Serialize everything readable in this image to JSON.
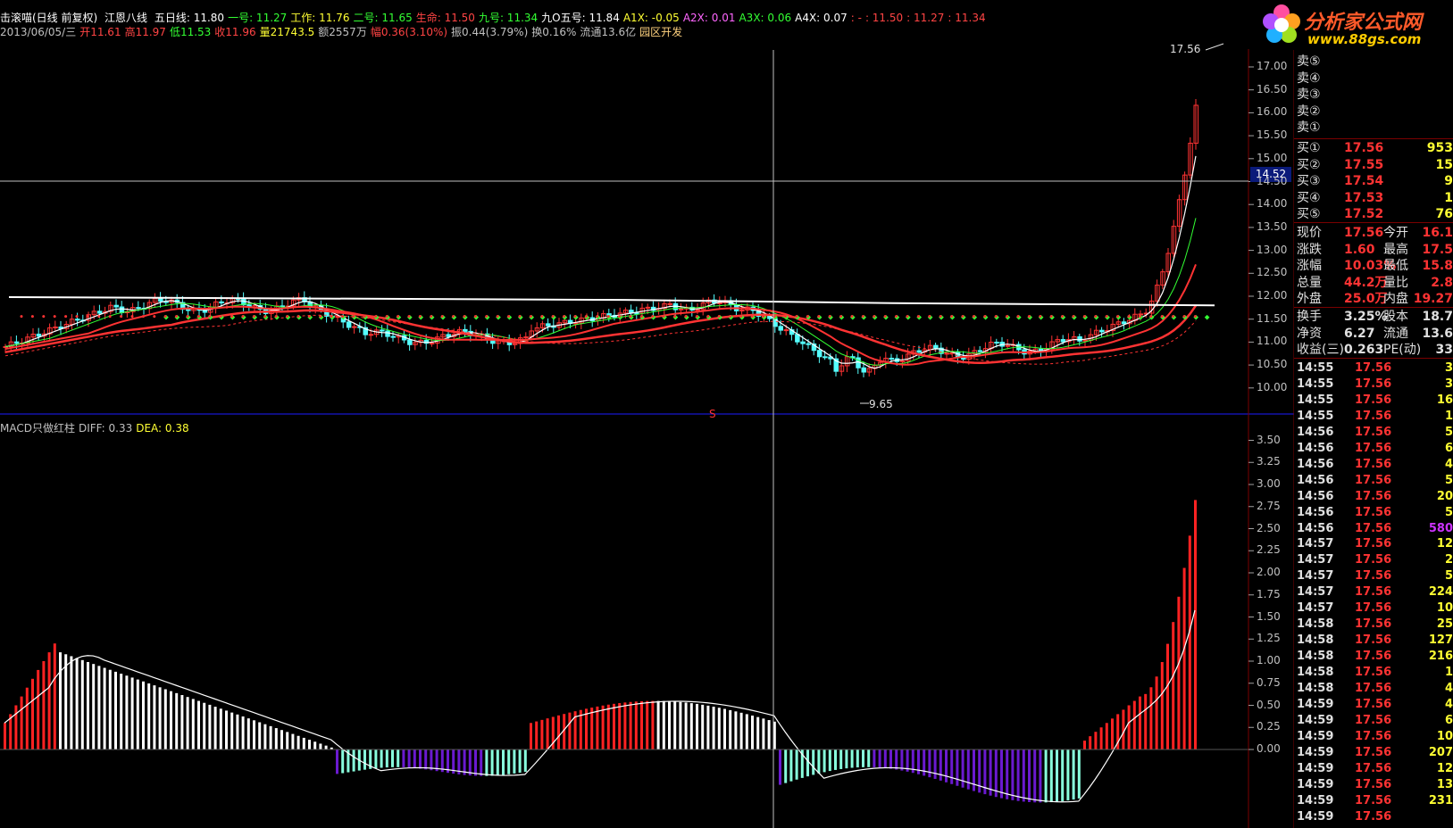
{
  "header": {
    "title": "击滚喵(日线 前复权)",
    "indicator": "江恩八线",
    "items": [
      {
        "label": "五日线: 11.80",
        "color": "#ffffff"
      },
      {
        "label": "一号: 11.27",
        "color": "#33ff33"
      },
      {
        "label": "工作: 11.76",
        "color": "#ffff33"
      },
      {
        "label": "二号: 11.65",
        "color": "#33ff33"
      },
      {
        "label": "生命: 11.50",
        "color": "#ff4444"
      },
      {
        "label": "九号: 11.34",
        "color": "#33ff33"
      },
      {
        "label": "九O五号: 11.84",
        "color": "#ffffff"
      },
      {
        "label": "A1X: -0.05",
        "color": "#ffff33"
      },
      {
        "label": "A2X: 0.01",
        "color": "#ff66ff"
      },
      {
        "label": "A3X: 0.06",
        "color": "#33ff33"
      },
      {
        "label": "A4X: 0.07",
        "color": "#ffffff"
      },
      {
        "label": ": -",
        "color": "#ff4444"
      },
      {
        "label": ": 11.50",
        "color": "#ff4444"
      },
      {
        "label": ": 11.27",
        "color": "#ff4444"
      },
      {
        "label": ": 11.34",
        "color": "#ff4444"
      }
    ]
  },
  "quote": {
    "items": [
      {
        "label": "2013/06/05/三",
        "color": "#c0c0c0"
      },
      {
        "label": "开11.61",
        "color": "#ff4444"
      },
      {
        "label": "高11.97",
        "color": "#ff4444"
      },
      {
        "label": "低11.53",
        "color": "#33ff33"
      },
      {
        "label": "收11.96",
        "color": "#ff4444"
      },
      {
        "label": "量21743.5",
        "color": "#ffff33"
      },
      {
        "label": "额2557万",
        "color": "#c0c0c0"
      },
      {
        "label": "幅0.36(3.10%)",
        "color": "#ff4444"
      },
      {
        "label": "振0.44(3.79%)",
        "color": "#c0c0c0"
      },
      {
        "label": "换0.16%",
        "color": "#c0c0c0"
      },
      {
        "label": "流通13.6亿",
        "color": "#c0c0c0"
      },
      {
        "label": "园区开发",
        "color": "#ffd27f"
      }
    ]
  },
  "macd_header": {
    "items": [
      {
        "label": "MACD只做红柱",
        "color": "#c0c0c0"
      },
      {
        "label": "DIFF: 0.33",
        "color": "#c0c0c0"
      },
      {
        "label": "DEA: 0.38",
        "color": "#ffff33"
      }
    ]
  },
  "logo": {
    "brand": "分析家公式网",
    "url": "www.88gs.com"
  },
  "cursor_price": "14.52",
  "price_axis": {
    "min": 10.0,
    "max": 17.0,
    "ticks": [
      "17.00",
      "16.50",
      "16.00",
      "15.50",
      "15.00",
      "14.50",
      "14.00",
      "13.50",
      "13.00",
      "12.50",
      "12.00",
      "11.50",
      "11.00",
      "10.50",
      "10.00"
    ]
  },
  "macd_axis": {
    "ticks": [
      "3.50",
      "3.25",
      "3.00",
      "2.75",
      "2.50",
      "2.25",
      "2.00",
      "1.75",
      "1.50",
      "1.25",
      "1.00",
      "0.75",
      "0.50",
      "0.25",
      "0.00"
    ]
  },
  "annotations": {
    "high": "17.56",
    "low": "9.65",
    "signal": "S"
  },
  "order_book": {
    "sell": [
      {
        "label": "卖⑤"
      },
      {
        "label": "卖④"
      },
      {
        "label": "卖③"
      },
      {
        "label": "卖②"
      },
      {
        "label": "卖①"
      }
    ],
    "buy": [
      {
        "label": "买①",
        "price": "17.56",
        "vol": "953"
      },
      {
        "label": "买②",
        "price": "17.55",
        "vol": "15"
      },
      {
        "label": "买③",
        "price": "17.54",
        "vol": "9"
      },
      {
        "label": "买④",
        "price": "17.53",
        "vol": "1"
      },
      {
        "label": "买⑤",
        "price": "17.52",
        "vol": "76"
      }
    ]
  },
  "stats": [
    {
      "l1": "现价",
      "v1": "17.56",
      "l2": "今开",
      "v2": "16.1"
    },
    {
      "l1": "涨跌",
      "v1": "1.60",
      "l2": "最高",
      "v2": "17.5"
    },
    {
      "l1": "涨幅",
      "v1": "10.03%",
      "l2": "最低",
      "v2": "15.8"
    },
    {
      "l1": "总量",
      "v1": "44.2万",
      "l2": "量比",
      "v2": "2.8"
    },
    {
      "l1": "外盘",
      "v1": "25.0万",
      "l2": "内盘",
      "v2": "19.27"
    }
  ],
  "stats2": [
    {
      "l1": "换手",
      "v1": "3.25%",
      "l2": "股本",
      "v2": "18.7"
    },
    {
      "l1": "净资",
      "v1": "6.27",
      "l2": "流通",
      "v2": "13.6"
    },
    {
      "l1": "收益(三)",
      "v1": "0.263",
      "l2": "PE(动)",
      "v2": "33"
    }
  ],
  "ticks": [
    {
      "t": "14:55",
      "p": "17.56",
      "v": "3"
    },
    {
      "t": "14:55",
      "p": "17.56",
      "v": "3"
    },
    {
      "t": "14:55",
      "p": "17.56",
      "v": "16"
    },
    {
      "t": "14:55",
      "p": "17.56",
      "v": "1"
    },
    {
      "t": "14:56",
      "p": "17.56",
      "v": "5"
    },
    {
      "t": "14:56",
      "p": "17.56",
      "v": "6"
    },
    {
      "t": "14:56",
      "p": "17.56",
      "v": "4"
    },
    {
      "t": "14:56",
      "p": "17.56",
      "v": "5"
    },
    {
      "t": "14:56",
      "p": "17.56",
      "v": "20"
    },
    {
      "t": "14:56",
      "p": "17.56",
      "v": "5"
    },
    {
      "t": "14:56",
      "p": "17.56",
      "v": "580"
    },
    {
      "t": "14:57",
      "p": "17.56",
      "v": "12"
    },
    {
      "t": "14:57",
      "p": "17.56",
      "v": "2"
    },
    {
      "t": "14:57",
      "p": "17.56",
      "v": "5"
    },
    {
      "t": "14:57",
      "p": "17.56",
      "v": "224"
    },
    {
      "t": "14:57",
      "p": "17.56",
      "v": "10"
    },
    {
      "t": "14:58",
      "p": "17.56",
      "v": "25"
    },
    {
      "t": "14:58",
      "p": "17.56",
      "v": "127"
    },
    {
      "t": "14:58",
      "p": "17.56",
      "v": "216"
    },
    {
      "t": "14:58",
      "p": "17.56",
      "v": "1"
    },
    {
      "t": "14:58",
      "p": "17.56",
      "v": "4"
    },
    {
      "t": "14:59",
      "p": "17.56",
      "v": "4"
    },
    {
      "t": "14:59",
      "p": "17.56",
      "v": "6"
    },
    {
      "t": "14:59",
      "p": "17.56",
      "v": "10"
    },
    {
      "t": "14:59",
      "p": "17.56",
      "v": "207"
    },
    {
      "t": "14:59",
      "p": "17.56",
      "v": "12"
    },
    {
      "t": "14:59",
      "p": "17.56",
      "v": "13"
    },
    {
      "t": "14:59",
      "p": "17.56",
      "v": "231"
    },
    {
      "t": "14:59",
      "p": "17.56",
      "v": ""
    }
  ],
  "colors": {
    "up": "#ff3333",
    "down": "#54ffff",
    "grid": "#7a0000",
    "axis": "#1c1cff"
  }
}
